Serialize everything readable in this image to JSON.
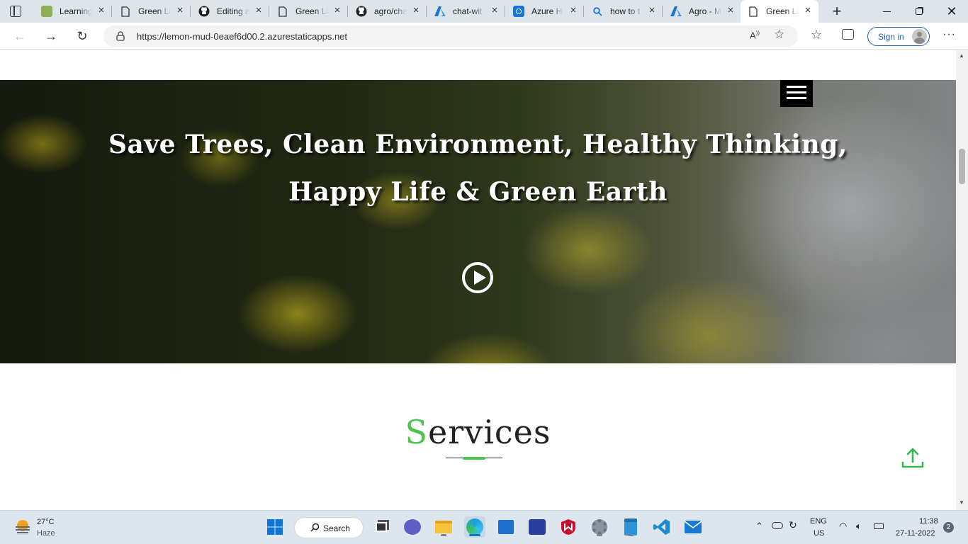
{
  "browser": {
    "tabs": [
      {
        "title": "Learning",
        "icon": "learning-favicon",
        "color": "#7a9a4a"
      },
      {
        "title": "Green Li",
        "icon": "page-icon"
      },
      {
        "title": "Editing a",
        "icon": "github-icon"
      },
      {
        "title": "Green Li",
        "icon": "page-icon"
      },
      {
        "title": "agro/cha",
        "icon": "github-icon"
      },
      {
        "title": "chat-wit",
        "icon": "azure-icon",
        "color": "#1677d8"
      },
      {
        "title": "Azure H",
        "icon": "azure-health-icon",
        "color": "#1677d8"
      },
      {
        "title": "how to t",
        "icon": "search-icon",
        "color": "#1677d8"
      },
      {
        "title": "Agro - M",
        "icon": "azure-icon",
        "color": "#1677d8"
      },
      {
        "title": "Green Li",
        "icon": "page-icon",
        "active": true
      }
    ],
    "url": "https://lemon-mud-0eaef6d00.2.azurestaticapps.net",
    "sign_in_label": "Sign in"
  },
  "page": {
    "hero": {
      "line1": "Save Trees, Clean Environment, Healthy Thinking,",
      "line2": "Happy Life & Green Earth"
    },
    "services": {
      "title_first_letter": "S",
      "title_rest": "ervices",
      "accent_color": "#4cc34c"
    }
  },
  "taskbar": {
    "weather_temp": "27°C",
    "weather_desc": "Haze",
    "search_label": "Search",
    "lang_top": "ENG",
    "lang_bottom": "US",
    "time": "11:38",
    "date": "27-11-2022",
    "notification_count": "2"
  }
}
